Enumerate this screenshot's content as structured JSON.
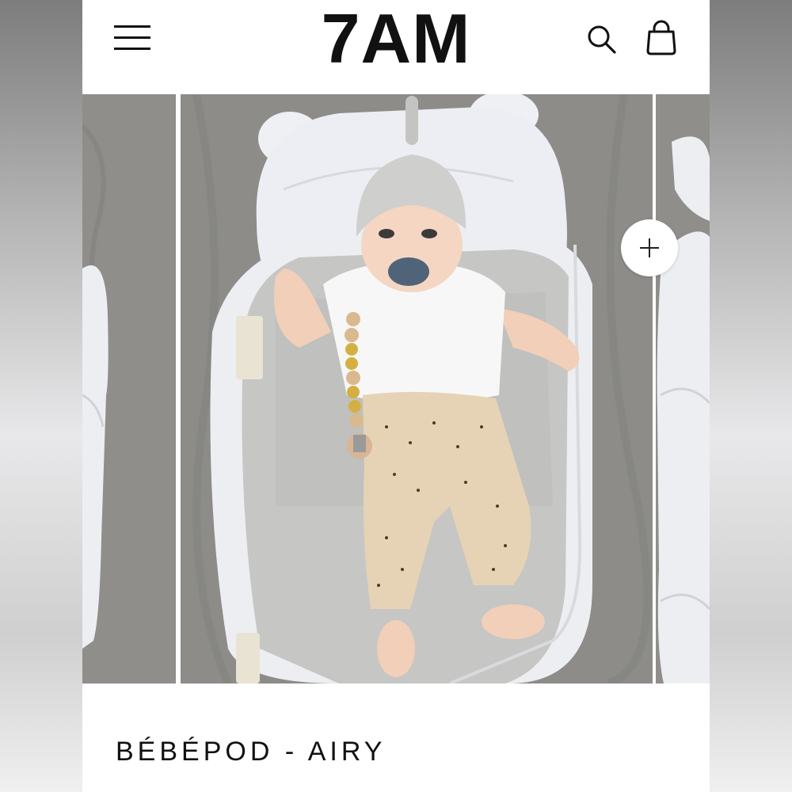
{
  "header": {
    "brand": "7AM",
    "menu_icon": "hamburger-menu-icon",
    "search_icon": "search-icon",
    "bag_icon": "shopping-bag-icon"
  },
  "gallery": {
    "zoom_icon": "plus-icon",
    "image_description": "Baby lying in a grey and white Bébépod nest with bear-ear pillow"
  },
  "product": {
    "title": "BÉBÉPOD - AIRY"
  },
  "colors": {
    "background": "#ffffff",
    "text": "#111111",
    "fabric_grey": "#c9c9c9",
    "backdrop_grey": "#8e8d8a"
  }
}
